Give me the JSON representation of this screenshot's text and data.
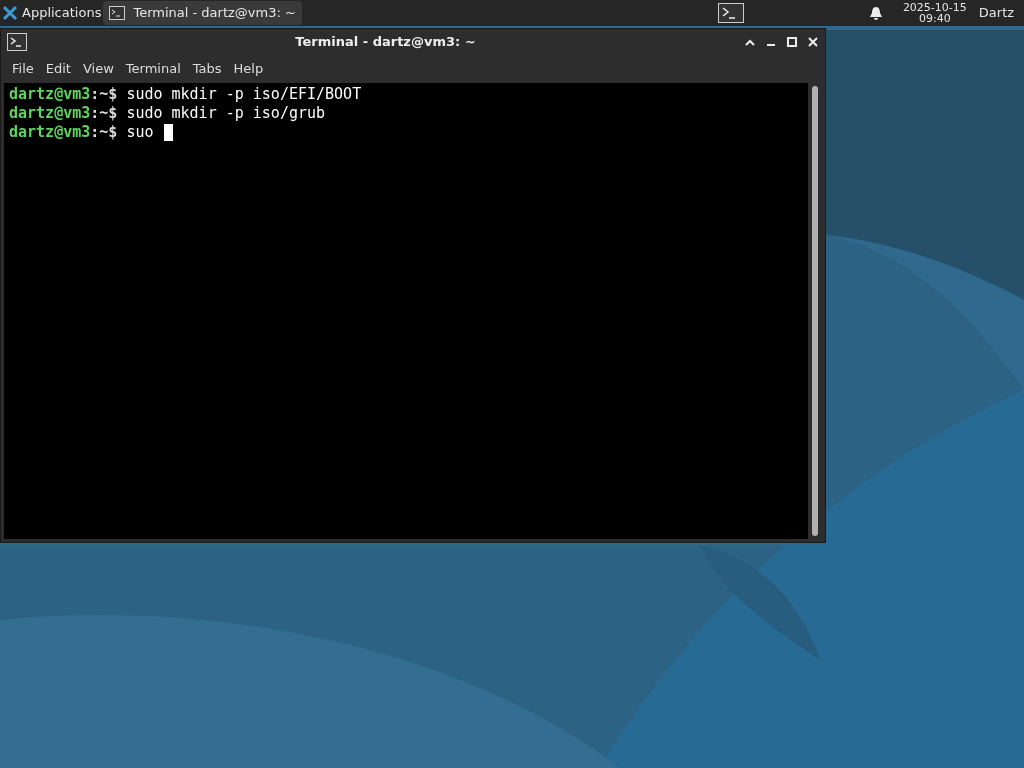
{
  "panel": {
    "menu": "Applications",
    "tasks": [
      {
        "title": "Terminal - dartz@vm3: ~",
        "selected": true
      }
    ],
    "date": "2025-10-15",
    "time": "09:40",
    "user": "Dartz"
  },
  "window": {
    "title": "Terminal - dartz@vm3: ~"
  },
  "menu": [
    "File",
    "Edit",
    "View",
    "Terminal",
    "Tabs",
    "Help"
  ],
  "terminal": {
    "lines": [
      {
        "prompt": "dartz@vm3",
        "path": ":~$",
        "command": "sudo mkdir -p iso/EFI/BOOT",
        "cursor": false
      },
      {
        "prompt": "dartz@vm3",
        "path": ":~$",
        "command": "sudo mkdir -p iso/grub",
        "cursor": false
      },
      {
        "prompt": "dartz@vm3",
        "path": ":~$",
        "command": "suo",
        "cursor": true
      }
    ]
  }
}
